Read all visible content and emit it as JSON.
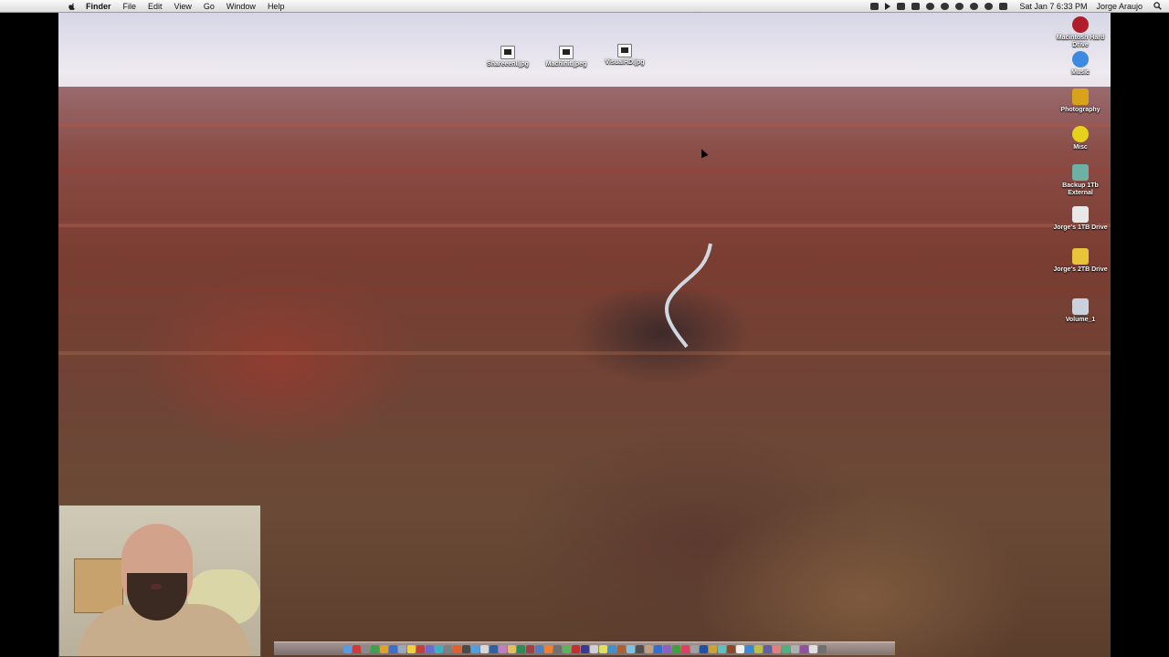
{
  "menubar": {
    "items": [
      "Finder",
      "File",
      "Edit",
      "View",
      "Go",
      "Window",
      "Help"
    ],
    "clock": "Sat Jan 7  6:33 PM",
    "user": "Jorge Araujo"
  },
  "desktop_files": [
    {
      "label": "Shareeenl.jpg",
      "icon": "image-file-icon"
    },
    {
      "label": "Machinit.jpeg",
      "icon": "image-file-icon"
    },
    {
      "label": "VisualHD.jpg",
      "icon": "image-file-icon"
    }
  ],
  "desktop_drives": [
    {
      "label": "Macintosh Hard Drive",
      "icon": "drive-icon",
      "color": "#b01d2a"
    },
    {
      "label": "Music",
      "icon": "music-drive-icon",
      "color": "#3d8be0"
    },
    {
      "label": "Photography",
      "icon": "camera-drive-icon",
      "color": "#d9a21b"
    },
    {
      "label": "Misc",
      "icon": "smiley-drive-icon",
      "color": "#e6d21c"
    },
    {
      "label": "Backup 1Tb External",
      "icon": "external-drive-icon",
      "color": "#6fb0a5"
    },
    {
      "label": "Jorge's 1TB Drive",
      "icon": "usb-drive-icon",
      "color": "#e8e8e8"
    },
    {
      "label": "Jorge's 2TB Drive",
      "icon": "yellow-drive-icon",
      "color": "#e9c43a"
    },
    {
      "label": "Volume_1",
      "icon": "network-volume-icon",
      "color": "#c9d2dc"
    }
  ],
  "dock_colors": [
    "#5a9be0",
    "#d23a3a",
    "#8a8a8a",
    "#3ea050",
    "#e0a030",
    "#3c70c8",
    "#9aa8b8",
    "#f0d040",
    "#c04040",
    "#6b6bd0",
    "#40b0c0",
    "#808080",
    "#e06030",
    "#4a4a4a",
    "#50a0e0",
    "#d8d8d8",
    "#3060a0",
    "#c080c0",
    "#e0c060",
    "#2a8a5a",
    "#a04040",
    "#5080c0",
    "#f08030",
    "#707070",
    "#60b060",
    "#c03030",
    "#3a3a8a",
    "#d0d0d0",
    "#e0e060",
    "#4090d0",
    "#b06030",
    "#80c0e0",
    "#505050",
    "#c0a080",
    "#3070d0",
    "#9060c0",
    "#40a040",
    "#e04060",
    "#a0a0a0",
    "#2050a0",
    "#d0a030",
    "#60c0c0",
    "#8a4a2a",
    "#f0f0f0",
    "#3a8ad0",
    "#c0c040",
    "#6060a0",
    "#e08080",
    "#50b080",
    "#b0b0b0",
    "#9050a0",
    "#e0e0e0",
    "#707070"
  ]
}
